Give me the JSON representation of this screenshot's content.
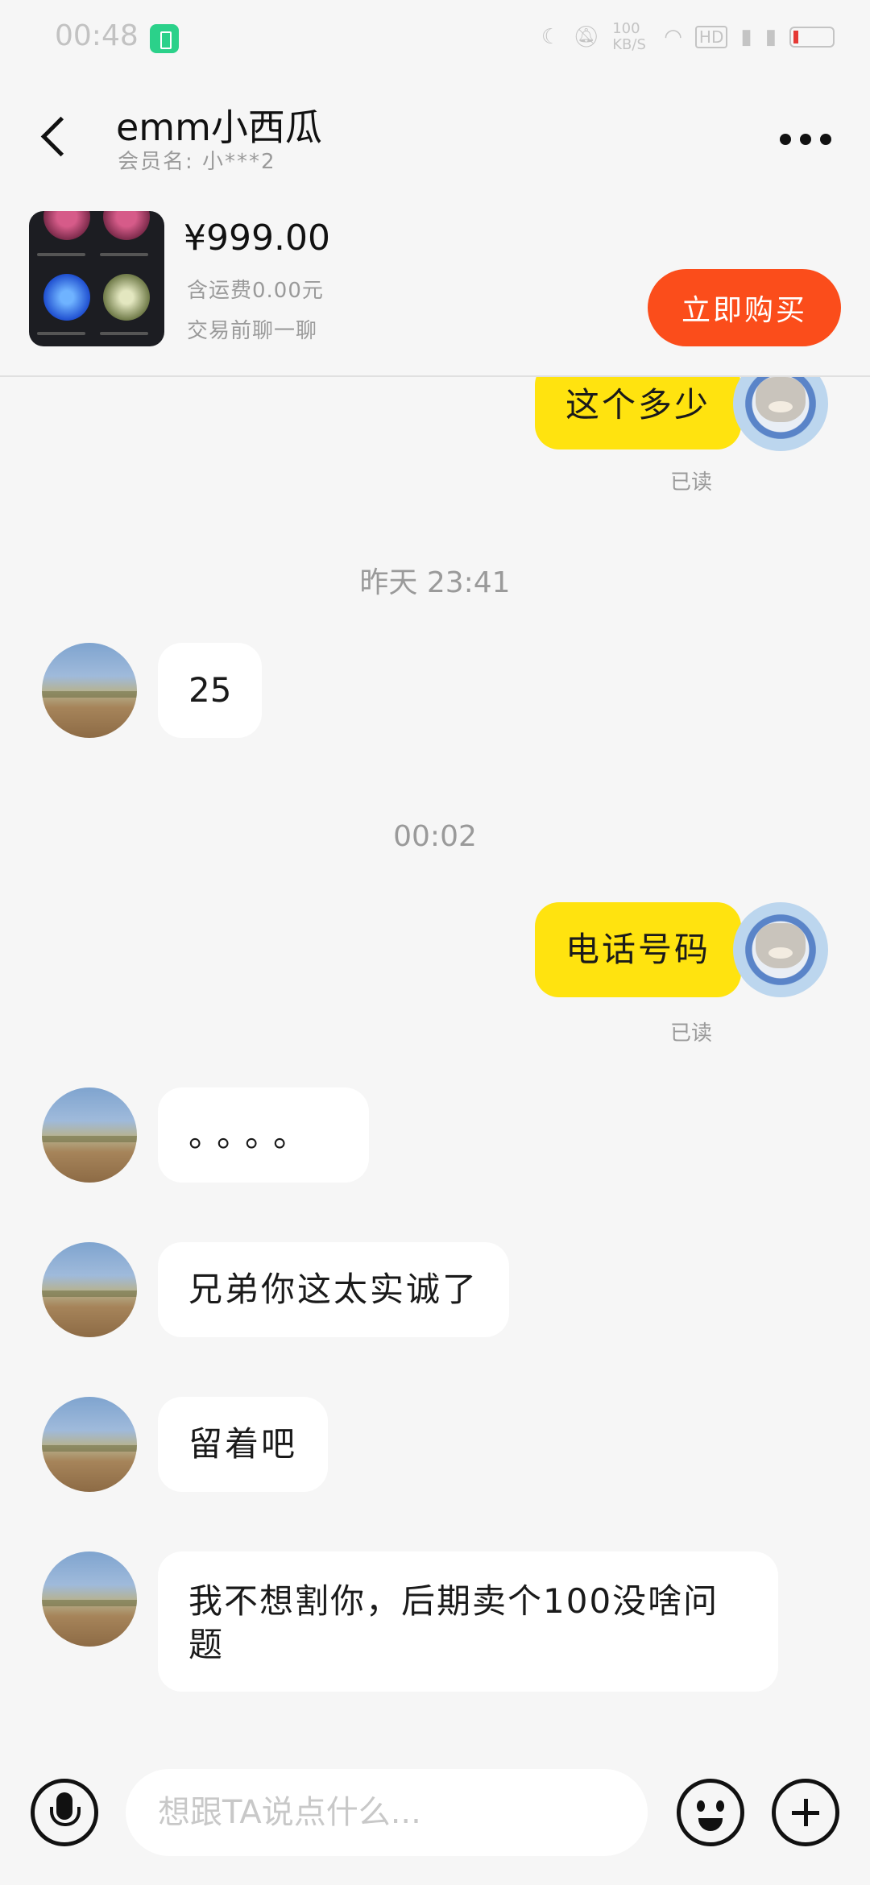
{
  "status_bar": {
    "time": "00:48",
    "indicators": [
      "moon-icon",
      "mute-icon",
      "speed-icon",
      "wifi-icon",
      "hd-icon",
      "signal-icon",
      "signal-icon",
      "battery-icon"
    ],
    "speed_text": "100 KB/S",
    "hd_text": "HD"
  },
  "header": {
    "title": "emm小西瓜",
    "subtitle": "会员名: 小***2"
  },
  "product": {
    "price": "¥999.00",
    "shipping": "含运费0.00元",
    "hint": "交易前聊一聊",
    "buy_label": "立即购买",
    "buy_color": "#fb4d1b"
  },
  "chat": {
    "messages": [
      {
        "side": "out",
        "text": "这个多少",
        "read": "已读"
      },
      {
        "timestamp": "昨天 23:41"
      },
      {
        "side": "in",
        "text": "25"
      },
      {
        "timestamp": "00:02"
      },
      {
        "side": "out",
        "text": "电话号码",
        "read": "已读"
      },
      {
        "side": "in",
        "text": "。。。。"
      },
      {
        "side": "in",
        "text": "兄弟你这太实诚了"
      },
      {
        "side": "in",
        "text": "留着吧"
      },
      {
        "side": "in",
        "text": "我不想割你，后期卖个100没啥问题"
      }
    ],
    "out_bubble_color": "#ffe30f",
    "in_bubble_color": "#ffffff"
  },
  "input": {
    "placeholder": "想跟TA说点什么..."
  }
}
